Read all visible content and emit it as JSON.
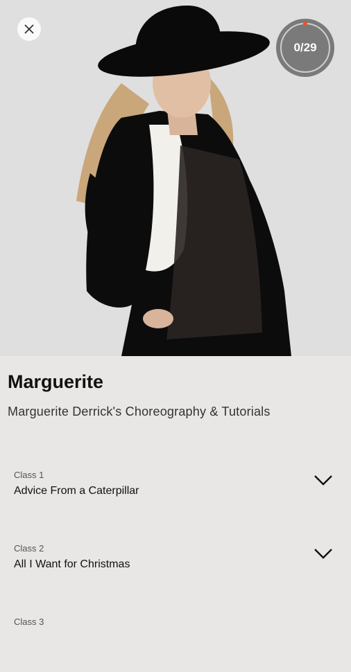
{
  "hero": {
    "image_alt": "Marguerite in black hat and outfit",
    "progress": {
      "label": "0/29",
      "completed": 0,
      "total": 29
    }
  },
  "course": {
    "title": "Marguerite",
    "subtitle": "Marguerite Derrick's Choreography & Tutorials"
  },
  "classes": [
    {
      "number": "Class 1",
      "name": "Advice From a Caterpillar"
    },
    {
      "number": "Class 2",
      "name": "All I Want for Christmas"
    },
    {
      "number": "Class 3",
      "name": ""
    }
  ],
  "colors": {
    "background": "#e9e6e6",
    "progress_accent": "#e8542a",
    "progress_bg": "#7a7a7a"
  },
  "icons": {
    "close": "close-icon",
    "expand": "chevron-down-icon"
  }
}
